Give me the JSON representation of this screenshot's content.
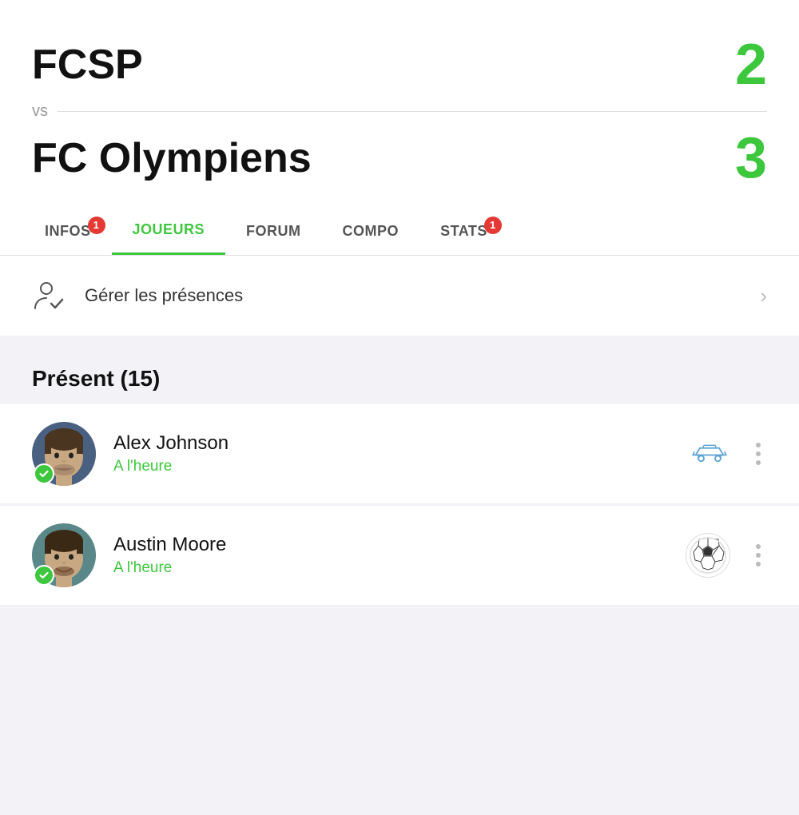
{
  "header": {
    "team1": {
      "name": "FCSP",
      "score": "2"
    },
    "vs": "vs",
    "team2": {
      "name": "FC Olympiens",
      "score": "3"
    }
  },
  "tabs": [
    {
      "id": "infos",
      "label": "INFOS",
      "badge": "1",
      "active": false
    },
    {
      "id": "joueurs",
      "label": "JOUEURS",
      "badge": null,
      "active": true
    },
    {
      "id": "forum",
      "label": "FORUM",
      "badge": null,
      "active": false
    },
    {
      "id": "compo",
      "label": "COMPO",
      "badge": null,
      "active": false
    },
    {
      "id": "stats",
      "label": "STATS",
      "badge": "1",
      "active": false
    }
  ],
  "manage": {
    "label": "Gérer les présences"
  },
  "present_section": {
    "title": "Présent (15)"
  },
  "players": [
    {
      "id": "alex-johnson",
      "name": "Alex Johnson",
      "status": "A l'heure",
      "icon_type": "car"
    },
    {
      "id": "austin-moore",
      "name": "Austin Moore",
      "status": "A l'heure",
      "icon_type": "ball"
    }
  ]
}
